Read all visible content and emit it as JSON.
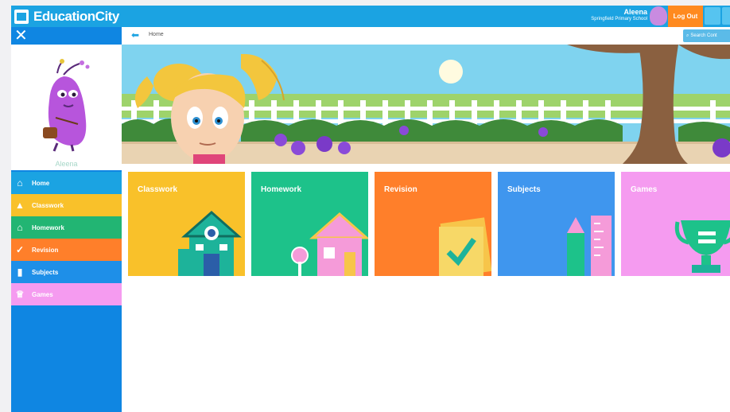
{
  "app": {
    "brand": "EducationCity"
  },
  "header": {
    "user_name": "Aleena",
    "school": "Springfield Primary School",
    "logout_label": "Log Out"
  },
  "breadcrumb": {
    "home": "Home"
  },
  "search": {
    "label": "Search Cont"
  },
  "profile": {
    "name": "Aleena"
  },
  "nav": [
    {
      "label": "Home",
      "color": "#1ba3e2",
      "icon": "home-icon"
    },
    {
      "label": "Classwork",
      "color": "#f9c12a",
      "icon": "classwork-icon"
    },
    {
      "label": "Homework",
      "color": "#22b573",
      "icon": "homework-icon"
    },
    {
      "label": "Revision",
      "color": "#ff7f2a",
      "icon": "revision-icon"
    },
    {
      "label": "Subjects",
      "color": "#1e8fe8",
      "icon": "subjects-icon"
    },
    {
      "label": "Games",
      "color": "#f59bf0",
      "icon": "trophy-icon"
    }
  ],
  "tiles": [
    {
      "label": "Classwork",
      "color": "#f9c12a"
    },
    {
      "label": "Homework",
      "color": "#1dc28a"
    },
    {
      "label": "Revision",
      "color": "#ff7f2a"
    },
    {
      "label": "Subjects",
      "color": "#3f96ee"
    },
    {
      "label": "Games",
      "color": "#f59bf0"
    }
  ]
}
